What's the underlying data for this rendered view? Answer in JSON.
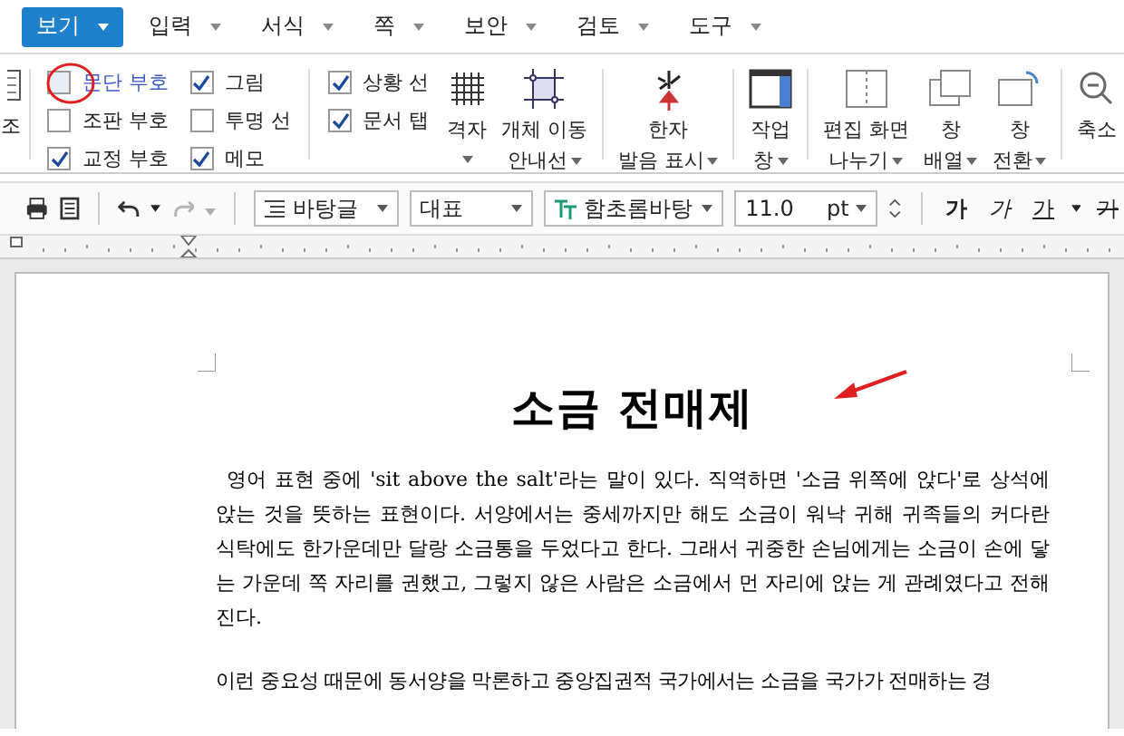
{
  "menu": {
    "items": [
      {
        "label": "보기",
        "selected": true
      },
      {
        "label": "입력",
        "selected": false
      },
      {
        "label": "서식",
        "selected": false
      },
      {
        "label": "쪽",
        "selected": false
      },
      {
        "label": "보안",
        "selected": false
      },
      {
        "label": "검토",
        "selected": false
      },
      {
        "label": "도구",
        "selected": false
      }
    ]
  },
  "ribbon": {
    "cut_item": {
      "label": "조"
    },
    "checkbox_groups": [
      [
        {
          "label": "문단 부호",
          "checked": false,
          "hover": true
        },
        {
          "label": "조판 부호",
          "checked": false,
          "hover": false
        },
        {
          "label": "교정 부호",
          "checked": true,
          "hover": false
        }
      ],
      [
        {
          "label": "그림",
          "checked": true,
          "hover": false
        },
        {
          "label": "투명 선",
          "checked": false,
          "hover": false
        },
        {
          "label": "메모",
          "checked": true,
          "hover": false
        }
      ],
      [
        {
          "label": "상황 선",
          "checked": true,
          "hover": false
        },
        {
          "label": "문서 탭",
          "checked": true,
          "hover": false
        }
      ]
    ],
    "buttons": [
      {
        "kind": "grid",
        "lines": [
          "격자"
        ]
      },
      {
        "kind": "guide",
        "lines": [
          "개체 이동",
          "안내선"
        ]
      },
      {
        "kind": "hanja",
        "lines": [
          "한자",
          "발음 표시"
        ]
      },
      {
        "kind": "pane",
        "lines": [
          "작업",
          "창"
        ]
      },
      {
        "kind": "split",
        "lines": [
          "편집 화면",
          "나누기"
        ]
      },
      {
        "kind": "arrange",
        "lines": [
          "창",
          "배열"
        ]
      },
      {
        "kind": "switch",
        "lines": [
          "창",
          "전환"
        ]
      },
      {
        "kind": "zoom",
        "lines": [
          "축소"
        ]
      }
    ]
  },
  "toolbar": {
    "redo": {
      "disabled": true
    },
    "style": "바탕글",
    "outline": "대표",
    "font": "함초롬바탕",
    "size": "11.0",
    "unit": "pt",
    "format_buttons": [
      {
        "kind": "bold",
        "label": "가"
      },
      {
        "kind": "italic",
        "label": "가"
      },
      {
        "kind": "underline",
        "label": "가"
      },
      {
        "kind": "strike",
        "label": "가"
      }
    ]
  },
  "document": {
    "title": "소금 전매제",
    "paragraphs": [
      "영어 표현 중에 'sit above the salt'라는 말이 있다. 직역하면 '소금 위쪽에 앉다'로 상석에 앉는 것을 뜻하는 표현이다. 서양에서는 중세까지만 해도 소금이 워낙 귀해 귀족들의 커다란 식탁에도 한가운데만 달랑 소금통을 두었다고 한다. 그래서 귀중한 손님에게는 소금이 손에 닿는 가운데 쪽 자리를 권했고, 그렇지 않은 사람은 소금에서 먼 자리에 앉는 게 관례였다고 전해진다.",
      "이런 중요성 때문에 동서양을 막론하고 중앙집권적 국가에서는 소금을 국가가 전매하는 경"
    ]
  }
}
